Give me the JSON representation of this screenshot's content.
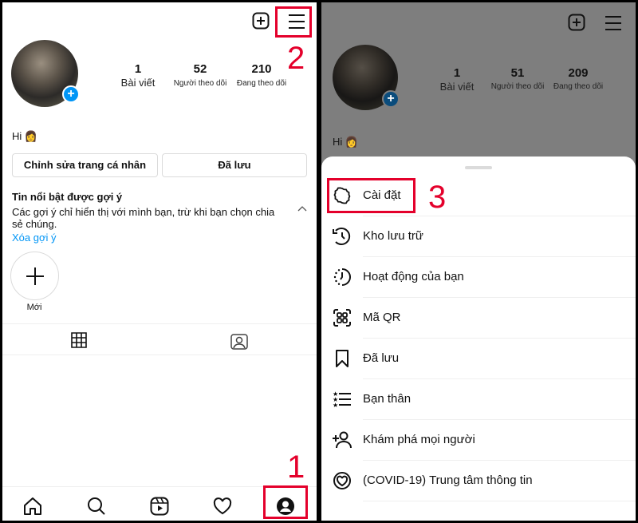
{
  "left": {
    "stats": [
      {
        "value": "1",
        "label": "Bài viết"
      },
      {
        "value": "52",
        "label": "Người theo dõi"
      },
      {
        "value": "210",
        "label": "Đang theo dõi"
      }
    ],
    "bio": "Hi 👩",
    "edit_profile_button": "Chỉnh sửa trang cá nhân",
    "saved_button": "Đã lưu",
    "highlights": {
      "title": "Tin nổi bật được gợi ý",
      "description": "Các gợi ý chỉ hiển thị với mình bạn, trừ khi bạn chọn chia sẻ chúng.",
      "remove_link": "Xóa gợi ý",
      "new_label": "Mới"
    },
    "step_labels": {
      "profile": "1",
      "menu": "2"
    },
    "nav_icons": [
      "home-icon",
      "search-icon",
      "reels-icon",
      "heart-icon",
      "profile-icon"
    ]
  },
  "right": {
    "stats": [
      {
        "value": "1",
        "label": "Bài viết"
      },
      {
        "value": "51",
        "label": "Người theo dõi"
      },
      {
        "value": "209",
        "label": "Đang theo dõi"
      }
    ],
    "bio": "Hi 👩",
    "step_label": "3",
    "menu": [
      {
        "icon": "settings-icon",
        "label": "Cài đặt"
      },
      {
        "icon": "archive-icon",
        "label": "Kho lưu trữ"
      },
      {
        "icon": "activity-icon",
        "label": "Hoạt động của bạn"
      },
      {
        "icon": "qr-code-icon",
        "label": "Mã QR"
      },
      {
        "icon": "bookmark-icon",
        "label": "Đã lưu"
      },
      {
        "icon": "close-friends-icon",
        "label": "Bạn thân"
      },
      {
        "icon": "discover-people-icon",
        "label": "Khám phá mọi người"
      },
      {
        "icon": "covid-info-icon",
        "label": "(COVID-19) Trung tâm thông tin"
      }
    ]
  },
  "colors": {
    "accent_blue": "#0095f6",
    "annotation_red": "#e4002b"
  }
}
